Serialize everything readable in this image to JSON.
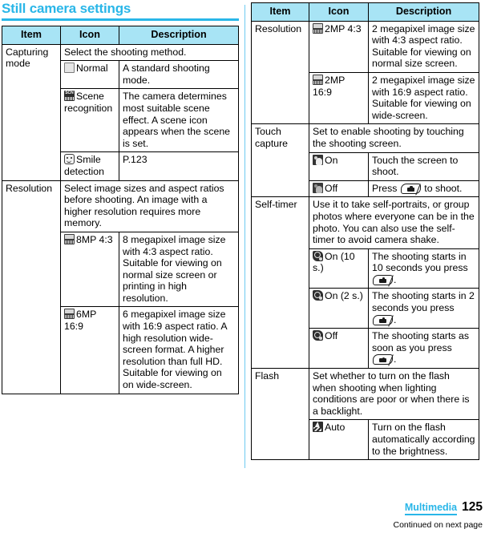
{
  "document": {
    "title": "Still camera settings",
    "accent_color": "#29b6e8",
    "header_fill": "#a8e4f5"
  },
  "columns": {
    "headers": {
      "item": "Item",
      "icon": "Icon",
      "description": "Description"
    }
  },
  "left_table": {
    "rows": [
      {
        "item": "Capturing mode",
        "intro": "Select the shooting method.",
        "options": [
          {
            "icon_name": "normal-mode-icon",
            "icon_label": "Normal",
            "description": "A standard shooting mode."
          },
          {
            "icon_name": "scene-recognition-icon",
            "icon_label": "Scene recognition",
            "description": "The camera determines most suitable scene effect. A scene icon appears when the scene is set."
          },
          {
            "icon_name": "smile-detection-icon",
            "icon_label": "Smile detection",
            "description": "P.123"
          }
        ]
      },
      {
        "item": "Resolution",
        "intro": "Select image sizes and aspect ratios before shooting. An image with a higher resolution requires more memory.",
        "options": [
          {
            "icon_name": "resolution-8mp-43-icon",
            "icon_label": "8MP 4:3",
            "description": "8 megapixel image size with 4:3 aspect ratio. Suitable for viewing on normal size screen or printing in high resolution."
          },
          {
            "icon_name": "resolution-6mp-169-icon",
            "icon_label": "6MP 16:9",
            "description": "6 megapixel image size with 16:9 aspect ratio. A high resolution wide-screen format. A higher resolution than full HD. Suitable for viewing on on wide-screen."
          }
        ]
      }
    ]
  },
  "right_table": {
    "rows": [
      {
        "item": "Resolution",
        "intro": null,
        "options": [
          {
            "icon_name": "resolution-2mp-43-icon",
            "icon_label": "2MP 4:3",
            "description": "2 megapixel image size with 4:3 aspect ratio. Suitable for viewing on normal size screen."
          },
          {
            "icon_name": "resolution-2mp-169-icon",
            "icon_label": "2MP 16:9",
            "description": "2 megapixel image size with 16:9 aspect ratio. Suitable for viewing on wide-screen."
          }
        ]
      },
      {
        "item": "Touch capture",
        "intro": "Set to enable shooting by touching the shooting screen.",
        "options": [
          {
            "icon_name": "touch-capture-on-icon",
            "icon_label": "On",
            "description": "Touch the screen to shoot."
          },
          {
            "icon_name": "touch-capture-off-icon",
            "icon_label": "Off",
            "description_pre": "Press",
            "description_post": "to shoot.",
            "has_camera_key": true
          }
        ]
      },
      {
        "item": "Self-timer",
        "intro": "Use it to take self-portraits, or group photos where everyone can be in the photo. You can also use the self-timer to avoid camera shake.",
        "options": [
          {
            "icon_name": "self-timer-on-10s-icon",
            "icon_label": "On (10 s.)",
            "description_pre": "The shooting starts in 10 seconds you press",
            "description_post": ".",
            "has_camera_key": true
          },
          {
            "icon_name": "self-timer-on-2s-icon",
            "icon_label": "On (2 s.)",
            "description_pre": "The shooting starts in 2 seconds you press",
            "description_post": ".",
            "has_camera_key": true
          },
          {
            "icon_name": "self-timer-off-icon",
            "icon_label": "Off",
            "description_pre": "The shooting starts as soon as you press",
            "description_post": ".",
            "has_camera_key": true
          }
        ]
      },
      {
        "item": "Flash",
        "intro": "Set whether to turn on the flash when shooting when lighting conditions are poor or when there is a backlight.",
        "options": [
          {
            "icon_name": "flash-auto-icon",
            "icon_label": "Auto",
            "description": "Turn on the flash automatically according to the brightness."
          }
        ]
      }
    ]
  },
  "footer": {
    "chapter": "Multimedia",
    "page_number": "125",
    "continued": "Continued on next page"
  }
}
